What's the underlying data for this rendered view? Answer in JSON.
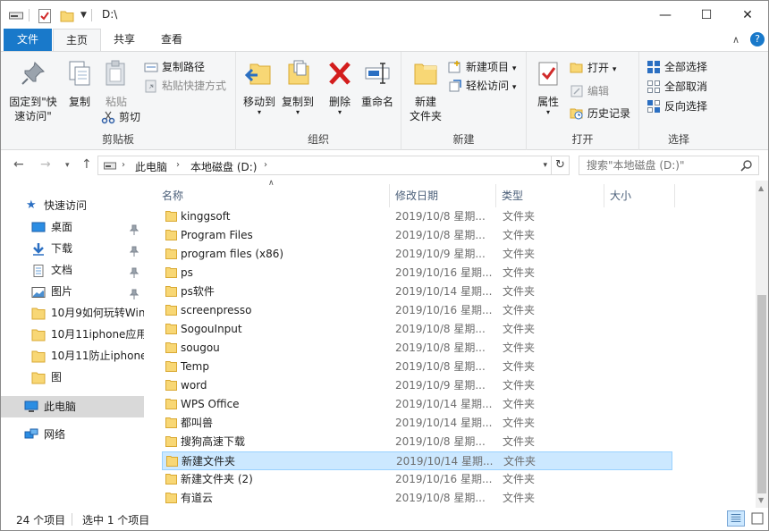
{
  "titlebar": {
    "path": "D:\\",
    "minimize": "—",
    "maximize": "☐",
    "close": "✕"
  },
  "tabs": {
    "file": "文件",
    "home": "主页",
    "share": "共享",
    "view": "查看",
    "help": "?"
  },
  "ribbon": {
    "clipboard": {
      "label": "剪贴板",
      "pin_line1": "固定到\"快",
      "pin_line2": "速访问\"",
      "copy": "复制",
      "paste": "粘贴",
      "copy_path": "复制路径",
      "paste_shortcut": "粘贴快捷方式",
      "cut": "剪切"
    },
    "organize": {
      "label": "组织",
      "move_to": "移动到",
      "copy_to": "复制到",
      "delete": "删除",
      "rename": "重命名"
    },
    "new": {
      "label": "新建",
      "new_folder_line1": "新建",
      "new_folder_line2": "文件夹",
      "new_item": "新建项目",
      "easy_access": "轻松访问"
    },
    "open": {
      "label": "打开",
      "properties": "属性",
      "open": "打开",
      "edit": "编辑",
      "history": "历史记录"
    },
    "select": {
      "label": "选择",
      "select_all": "全部选择",
      "select_none": "全部取消",
      "invert": "反向选择"
    }
  },
  "address": {
    "crumbs": [
      "此电脑",
      "本地磁盘 (D:)"
    ],
    "search_placeholder": "搜索\"本地磁盘 (D:)\""
  },
  "navpane": {
    "quick_access": "快速访问",
    "items": [
      {
        "label": "桌面",
        "icon": "desktop-icon",
        "pinned": true
      },
      {
        "label": "下载",
        "icon": "download-icon",
        "pinned": true
      },
      {
        "label": "文档",
        "icon": "document-icon",
        "pinned": true
      },
      {
        "label": "图片",
        "icon": "picture-icon",
        "pinned": true
      },
      {
        "label": "10月9如何玩转Win",
        "icon": "folder-icon",
        "pinned": false
      },
      {
        "label": "10月11iphone应用",
        "icon": "folder-icon",
        "pinned": false
      },
      {
        "label": "10月11防止iphone",
        "icon": "folder-icon",
        "pinned": false
      },
      {
        "label": "图",
        "icon": "folder-icon",
        "pinned": false
      }
    ],
    "this_pc": "此电脑",
    "network": "网络"
  },
  "columns": {
    "name": "名称",
    "date": "修改日期",
    "type": "类型",
    "size": "大小"
  },
  "files": [
    {
      "name": "kinggsoft",
      "date": "2019/10/8 星期...",
      "type": "文件夹"
    },
    {
      "name": "Program Files",
      "date": "2019/10/8 星期...",
      "type": "文件夹"
    },
    {
      "name": "program files (x86)",
      "date": "2019/10/9 星期...",
      "type": "文件夹"
    },
    {
      "name": "ps",
      "date": "2019/10/16 星期...",
      "type": "文件夹"
    },
    {
      "name": "ps软件",
      "date": "2019/10/14 星期...",
      "type": "文件夹"
    },
    {
      "name": "screenpresso",
      "date": "2019/10/16 星期...",
      "type": "文件夹"
    },
    {
      "name": "SogouInput",
      "date": "2019/10/8 星期...",
      "type": "文件夹"
    },
    {
      "name": "sougou",
      "date": "2019/10/8 星期...",
      "type": "文件夹"
    },
    {
      "name": "Temp",
      "date": "2019/10/8 星期...",
      "type": "文件夹"
    },
    {
      "name": "word",
      "date": "2019/10/9 星期...",
      "type": "文件夹"
    },
    {
      "name": "WPS Office",
      "date": "2019/10/14 星期...",
      "type": "文件夹"
    },
    {
      "name": "都叫兽",
      "date": "2019/10/14 星期...",
      "type": "文件夹"
    },
    {
      "name": "搜狗高速下载",
      "date": "2019/10/8 星期...",
      "type": "文件夹"
    },
    {
      "name": "新建文件夹",
      "date": "2019/10/14 星期...",
      "type": "文件夹",
      "selected": true
    },
    {
      "name": "新建文件夹 (2)",
      "date": "2019/10/16 星期...",
      "type": "文件夹"
    },
    {
      "name": "有道云",
      "date": "2019/10/8 星期...",
      "type": "文件夹"
    }
  ],
  "status": {
    "item_count": "24 个项目",
    "selected_count": "选中 1 个项目"
  },
  "colors": {
    "accent": "#1979ca",
    "selection": "#cce8ff",
    "folder": "#f8d775"
  }
}
